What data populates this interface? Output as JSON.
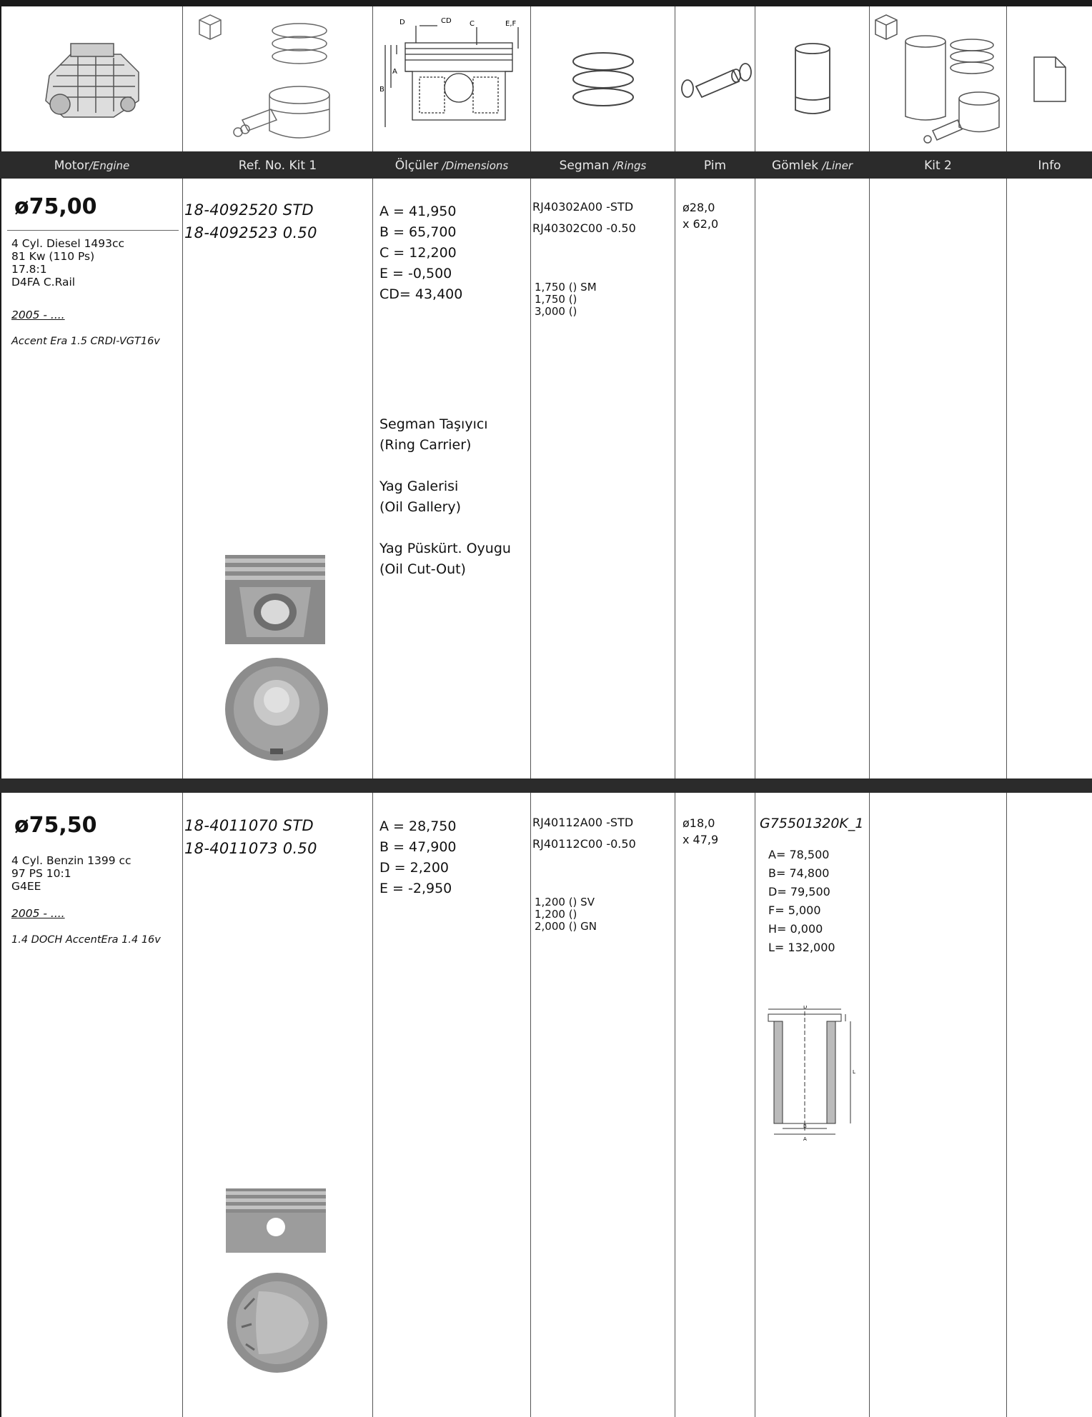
{
  "header": {
    "columns": [
      {
        "label": "Motor",
        "sub": "/Engine"
      },
      {
        "label": "Ref. No. Kit 1",
        "sub": ""
      },
      {
        "label": "Ölçüler",
        "sub": "/Dimensions"
      },
      {
        "label": "Segman",
        "sub": "/Rings"
      },
      {
        "label": "Pim",
        "sub": ""
      },
      {
        "label": "Gömlek",
        "sub": "/Liner"
      },
      {
        "label": "Kit 2",
        "sub": ""
      },
      {
        "label": "Info",
        "sub": ""
      }
    ],
    "diagram_labels": {
      "d": "D",
      "cd": "CD",
      "c": "C",
      "ef": "E,F",
      "a": "A",
      "b": "B"
    }
  },
  "entries": [
    {
      "bore": "ø75,00",
      "engine_lines": [
        "4 Cyl. Diesel 1493cc",
        "81 Kw (110 Ps)",
        "17.8:1",
        "D4FA C.Rail"
      ],
      "years": "2005 - ....",
      "model": "Accent Era 1.5 CRDI-VGT16v",
      "refs": [
        "18-4092520  STD",
        "18-4092523  0.50"
      ],
      "dims": [
        "A  = 41,950",
        "B  = 65,700",
        "C  = 12,200",
        "E  = -0,500",
        "CD= 43,400"
      ],
      "features": [
        "Segman Taşıyıcı",
        "(Ring Carrier)",
        "",
        "Yag Galerisi",
        "(Oil Gallery)",
        "",
        "Yag Püskürt. Oyugu",
        "(Oil Cut-Out)"
      ],
      "ring_refs": [
        "RJ40302A00 -STD",
        "RJ40302C00 -0.50"
      ],
      "ring_sizes": [
        "1,750  () SM",
        "1,750  ()",
        "3,000  ()"
      ],
      "pin": [
        "ø28,0",
        "x 62,0"
      ],
      "liner_code": "",
      "liner_dims": []
    },
    {
      "bore": "ø75,50",
      "engine_lines": [
        "4 Cyl. Benzin 1399 cc",
        "97 PS 10:1",
        "G4EE"
      ],
      "years": "2005 - ....",
      "model": "1.4 DOCH AccentEra 1.4 16v",
      "refs": [
        "18-4011070  STD",
        "18-4011073  0.50"
      ],
      "dims": [
        "A  = 28,750",
        "B  = 47,900",
        "D  = 2,200",
        "E  = -2,950"
      ],
      "features": [],
      "ring_refs": [
        "RJ40112A00 -STD",
        "RJ40112C00 -0.50"
      ],
      "ring_sizes": [
        "1,200  () SV",
        "1,200  ()",
        "2,000  () GN"
      ],
      "pin": [
        "ø18,0",
        "x 47,9"
      ],
      "liner_code": "G75501320K_1",
      "liner_dims": [
        "A= 78,500",
        "B= 74,800",
        "D= 79,500",
        "F= 5,000",
        "H= 0,000",
        "L= 132,000"
      ]
    }
  ],
  "liner_drawing_labels": {
    "d": "D",
    "l": "L",
    "b": "B",
    "a": "A"
  }
}
